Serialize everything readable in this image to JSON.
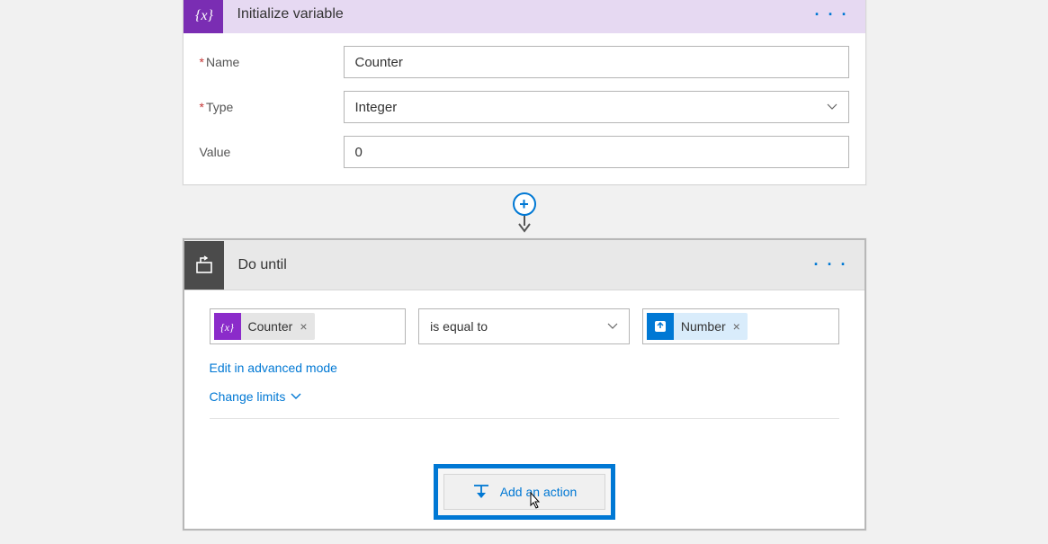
{
  "initVar": {
    "title": "Initialize variable",
    "fields": {
      "nameLabel": "Name",
      "nameValue": "Counter",
      "typeLabel": "Type",
      "typeValue": "Integer",
      "valueLabel": "Value",
      "valueValue": "0"
    }
  },
  "doUntil": {
    "title": "Do until",
    "leftToken": "Counter",
    "operator": "is equal to",
    "rightToken": "Number",
    "advancedLink": "Edit in advanced mode",
    "changeLimits": "Change limits",
    "addAction": "Add an action"
  }
}
